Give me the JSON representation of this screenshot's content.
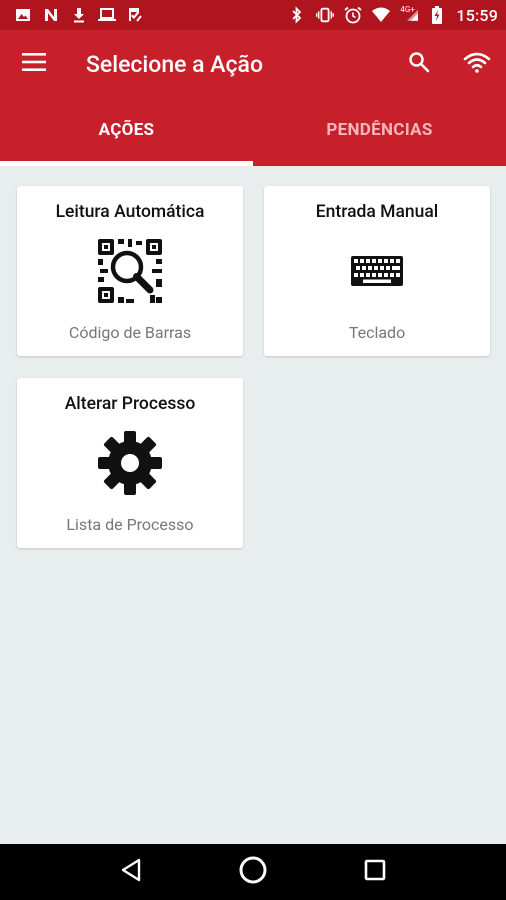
{
  "status_bar": {
    "time": "15:59",
    "network_label": "4G+",
    "left_icons": [
      "image-icon",
      "n-app-icon",
      "download-icon",
      "laptop-icon",
      "clipboard-check-icon"
    ],
    "right_icons": [
      "bluetooth-icon",
      "vibrate-icon",
      "alarm-icon",
      "wifi-icon",
      "signal-icon",
      "battery-icon"
    ]
  },
  "app_bar": {
    "title": "Selecione a Ação",
    "color": "#c8202b",
    "menu_icon": "menu-icon",
    "actions": [
      "search-icon",
      "wifi-icon"
    ]
  },
  "tabs": [
    {
      "label": "AÇÕES",
      "active": true
    },
    {
      "label": "PENDÊNCIAS",
      "active": false
    }
  ],
  "cards": [
    {
      "title": "Leitura Automática",
      "icon": "qr-search-icon",
      "subtitle": "Código de Barras"
    },
    {
      "title": "Entrada Manual",
      "icon": "keyboard-icon",
      "subtitle": "Teclado"
    },
    {
      "title": "Alterar Processo",
      "icon": "gear-icon",
      "subtitle": "Lista de Processo"
    }
  ],
  "nav_bar": {
    "buttons": [
      "back-icon",
      "home-icon",
      "recents-icon"
    ]
  }
}
